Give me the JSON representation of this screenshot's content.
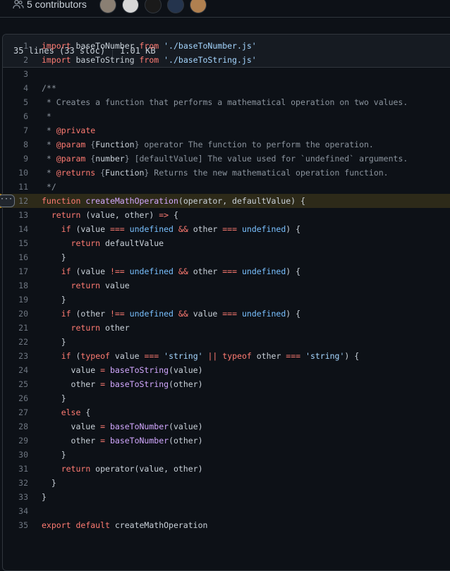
{
  "contributors": {
    "label": "5 contributors",
    "avatars": [
      {
        "color": "#8a7f73"
      },
      {
        "color": "#d7d7d7"
      },
      {
        "color": "#1a1a1a"
      },
      {
        "color": "#24344d"
      },
      {
        "color": "#b08050"
      }
    ]
  },
  "file_header": {
    "lines": "35 lines (33 sloc)",
    "size": "1.01 KB"
  },
  "code": {
    "highlighted_line": 12,
    "lines": [
      [
        {
          "t": "import",
          "c": "kw"
        },
        {
          "t": " baseToNumber "
        },
        {
          "t": "from",
          "c": "kw"
        },
        {
          "t": " "
        },
        {
          "t": "'./baseToNumber.js'",
          "c": "str"
        }
      ],
      [
        {
          "t": "import",
          "c": "kw"
        },
        {
          "t": " baseToString "
        },
        {
          "t": "from",
          "c": "kw"
        },
        {
          "t": " "
        },
        {
          "t": "'./baseToString.js'",
          "c": "str"
        }
      ],
      [],
      [
        {
          "t": "/**",
          "c": "cm"
        }
      ],
      [
        {
          "t": " * Creates a function that performs a mathematical operation on two values.",
          "c": "cm"
        }
      ],
      [
        {
          "t": " *",
          "c": "cm"
        }
      ],
      [
        {
          "t": " * ",
          "c": "cm"
        },
        {
          "t": "@private",
          "c": "kw"
        }
      ],
      [
        {
          "t": " * ",
          "c": "cm"
        },
        {
          "t": "@param",
          "c": "kw"
        },
        {
          "t": " {",
          "c": "cm"
        },
        {
          "t": "Function"
        },
        {
          "t": "} operator The function to perform the operation.",
          "c": "cm"
        }
      ],
      [
        {
          "t": " * ",
          "c": "cm"
        },
        {
          "t": "@param",
          "c": "kw"
        },
        {
          "t": " {",
          "c": "cm"
        },
        {
          "t": "number"
        },
        {
          "t": "} [defaultValue] The value used for `undefined` arguments.",
          "c": "cm"
        }
      ],
      [
        {
          "t": " * ",
          "c": "cm"
        },
        {
          "t": "@returns",
          "c": "kw"
        },
        {
          "t": " {",
          "c": "cm"
        },
        {
          "t": "Function"
        },
        {
          "t": "} Returns the new mathematical operation function.",
          "c": "cm"
        }
      ],
      [
        {
          "t": " */",
          "c": "cm"
        }
      ],
      [
        {
          "t": "function",
          "c": "kw"
        },
        {
          "t": " "
        },
        {
          "t": "createMathOperation",
          "c": "fn"
        },
        {
          "t": "(operator, defaultValue) {"
        }
      ],
      [
        {
          "t": "  "
        },
        {
          "t": "return",
          "c": "kw"
        },
        {
          "t": " (value, other) "
        },
        {
          "t": "=>",
          "c": "kw"
        },
        {
          "t": " {"
        }
      ],
      [
        {
          "t": "    "
        },
        {
          "t": "if",
          "c": "kw"
        },
        {
          "t": " (value "
        },
        {
          "t": "===",
          "c": "kw"
        },
        {
          "t": " "
        },
        {
          "t": "undefined",
          "c": "const"
        },
        {
          "t": " "
        },
        {
          "t": "&&",
          "c": "kw"
        },
        {
          "t": " other "
        },
        {
          "t": "===",
          "c": "kw"
        },
        {
          "t": " "
        },
        {
          "t": "undefined",
          "c": "const"
        },
        {
          "t": ") {"
        }
      ],
      [
        {
          "t": "      "
        },
        {
          "t": "return",
          "c": "kw"
        },
        {
          "t": " defaultValue"
        }
      ],
      [
        {
          "t": "    }"
        }
      ],
      [
        {
          "t": "    "
        },
        {
          "t": "if",
          "c": "kw"
        },
        {
          "t": " (value "
        },
        {
          "t": "!==",
          "c": "kw"
        },
        {
          "t": " "
        },
        {
          "t": "undefined",
          "c": "const"
        },
        {
          "t": " "
        },
        {
          "t": "&&",
          "c": "kw"
        },
        {
          "t": " other "
        },
        {
          "t": "===",
          "c": "kw"
        },
        {
          "t": " "
        },
        {
          "t": "undefined",
          "c": "const"
        },
        {
          "t": ") {"
        }
      ],
      [
        {
          "t": "      "
        },
        {
          "t": "return",
          "c": "kw"
        },
        {
          "t": " value"
        }
      ],
      [
        {
          "t": "    }"
        }
      ],
      [
        {
          "t": "    "
        },
        {
          "t": "if",
          "c": "kw"
        },
        {
          "t": " (other "
        },
        {
          "t": "!==",
          "c": "kw"
        },
        {
          "t": " "
        },
        {
          "t": "undefined",
          "c": "const"
        },
        {
          "t": " "
        },
        {
          "t": "&&",
          "c": "kw"
        },
        {
          "t": " value "
        },
        {
          "t": "===",
          "c": "kw"
        },
        {
          "t": " "
        },
        {
          "t": "undefined",
          "c": "const"
        },
        {
          "t": ") {"
        }
      ],
      [
        {
          "t": "      "
        },
        {
          "t": "return",
          "c": "kw"
        },
        {
          "t": " other"
        }
      ],
      [
        {
          "t": "    }"
        }
      ],
      [
        {
          "t": "    "
        },
        {
          "t": "if",
          "c": "kw"
        },
        {
          "t": " ("
        },
        {
          "t": "typeof",
          "c": "kw"
        },
        {
          "t": " value "
        },
        {
          "t": "===",
          "c": "kw"
        },
        {
          "t": " "
        },
        {
          "t": "'string'",
          "c": "str"
        },
        {
          "t": " "
        },
        {
          "t": "||",
          "c": "kw"
        },
        {
          "t": " "
        },
        {
          "t": "typeof",
          "c": "kw"
        },
        {
          "t": " other "
        },
        {
          "t": "===",
          "c": "kw"
        },
        {
          "t": " "
        },
        {
          "t": "'string'",
          "c": "str"
        },
        {
          "t": ") {"
        }
      ],
      [
        {
          "t": "      value "
        },
        {
          "t": "=",
          "c": "kw"
        },
        {
          "t": " "
        },
        {
          "t": "baseToString",
          "c": "fn"
        },
        {
          "t": "(value)"
        }
      ],
      [
        {
          "t": "      other "
        },
        {
          "t": "=",
          "c": "kw"
        },
        {
          "t": " "
        },
        {
          "t": "baseToString",
          "c": "fn"
        },
        {
          "t": "(other)"
        }
      ],
      [
        {
          "t": "    }"
        }
      ],
      [
        {
          "t": "    "
        },
        {
          "t": "else",
          "c": "kw"
        },
        {
          "t": " {"
        }
      ],
      [
        {
          "t": "      value "
        },
        {
          "t": "=",
          "c": "kw"
        },
        {
          "t": " "
        },
        {
          "t": "baseToNumber",
          "c": "fn"
        },
        {
          "t": "(value)"
        }
      ],
      [
        {
          "t": "      other "
        },
        {
          "t": "=",
          "c": "kw"
        },
        {
          "t": " "
        },
        {
          "t": "baseToNumber",
          "c": "fn"
        },
        {
          "t": "(other)"
        }
      ],
      [
        {
          "t": "    }"
        }
      ],
      [
        {
          "t": "    "
        },
        {
          "t": "return",
          "c": "kw"
        },
        {
          "t": " operator(value, other)"
        }
      ],
      [
        {
          "t": "  }"
        }
      ],
      [
        {
          "t": "}"
        }
      ],
      [],
      [
        {
          "t": "export",
          "c": "kw"
        },
        {
          "t": " "
        },
        {
          "t": "default",
          "c": "kw"
        },
        {
          "t": " createMathOperation"
        }
      ]
    ]
  },
  "icons": {
    "contributors": "people-icon",
    "line_actions": "kebab-horizontal-icon"
  }
}
